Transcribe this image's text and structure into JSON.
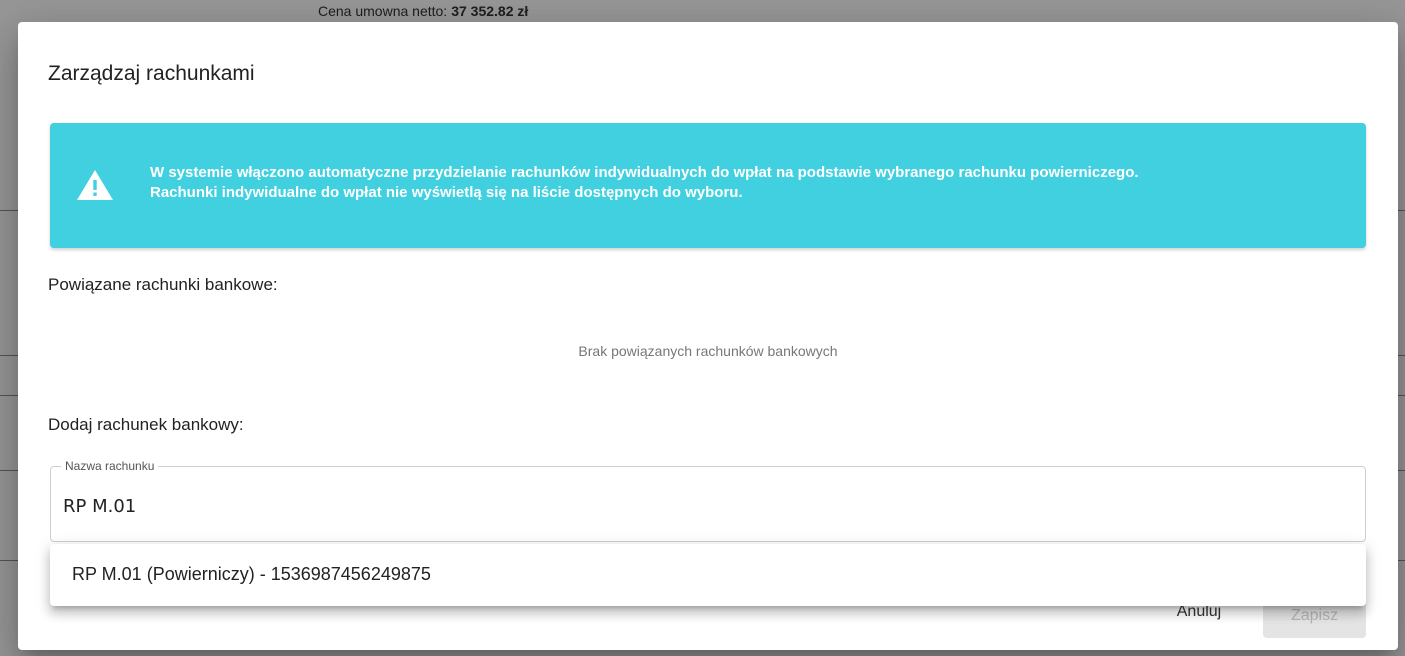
{
  "background": {
    "contract_price_label": "Cena umowna netto:",
    "contract_price_value": "37 352.82 zł"
  },
  "dialog": {
    "title": "Zarządzaj rachunkami",
    "alert": {
      "icon": "warning-icon",
      "color": "#40d0e0",
      "line1": "W systemie włączono automatyczne przydzielanie rachunków indywidualnych do wpłat na podstawie wybranego rachunku powierniczego.",
      "line2": "Rachunki indywidualne do wpłat nie wyświetlą się na liście dostępnych do wyboru."
    },
    "linked_accounts": {
      "label": "Powiązane rachunki bankowe:",
      "empty_text": "Brak powiązanych rachunków bankowych"
    },
    "add_account": {
      "label": "Dodaj rachunek bankowy:",
      "field_label": "Nazwa rachunku",
      "field_value": "RP M.01"
    },
    "autocomplete": {
      "options": [
        "RP M.01 (Powierniczy) - 1536987456249875"
      ]
    },
    "buttons": {
      "cancel": "Anuluj",
      "save": "Zapisz"
    }
  }
}
